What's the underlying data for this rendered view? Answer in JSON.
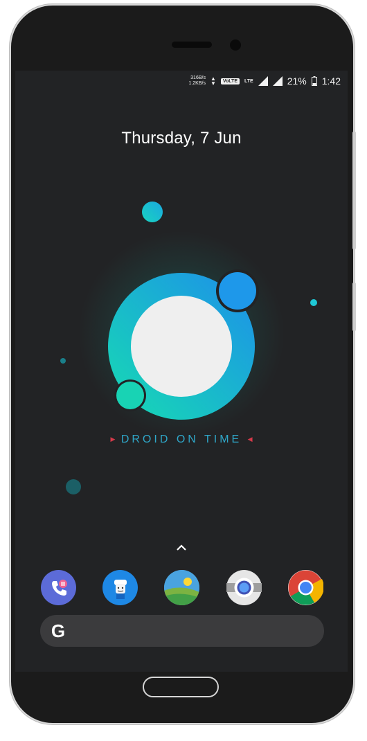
{
  "status_bar": {
    "upload_speed": "316B/s",
    "download_speed": "1.2KB/s",
    "volte_label": "VoLTE",
    "lte_label": "LTE",
    "battery_percent": "21%",
    "time": "1:42"
  },
  "lockscreen": {
    "date": "Thursday, 7 Jun",
    "wallpaper_title": "DROID ON TIME"
  },
  "dock": {
    "apps": [
      {
        "name": "Phone",
        "icon": "phone-icon",
        "color": "#5c6bd8"
      },
      {
        "name": "Contacts",
        "icon": "contacts-icon",
        "color": "#1e88e5"
      },
      {
        "name": "Gallery",
        "icon": "gallery-icon",
        "color": "#43a047"
      },
      {
        "name": "Camera",
        "icon": "camera-icon",
        "color": "#e0e0e0"
      },
      {
        "name": "Chrome",
        "icon": "chrome-icon",
        "color": "#db4437"
      }
    ]
  },
  "search_bar": {
    "logo_letter": "G"
  },
  "colors": {
    "screen_bg": "#222325",
    "accent_teal": "#19d2b4",
    "accent_blue": "#1e9be8",
    "logo_text": "#2fa7c9",
    "triangle_red": "#d63a4a"
  }
}
